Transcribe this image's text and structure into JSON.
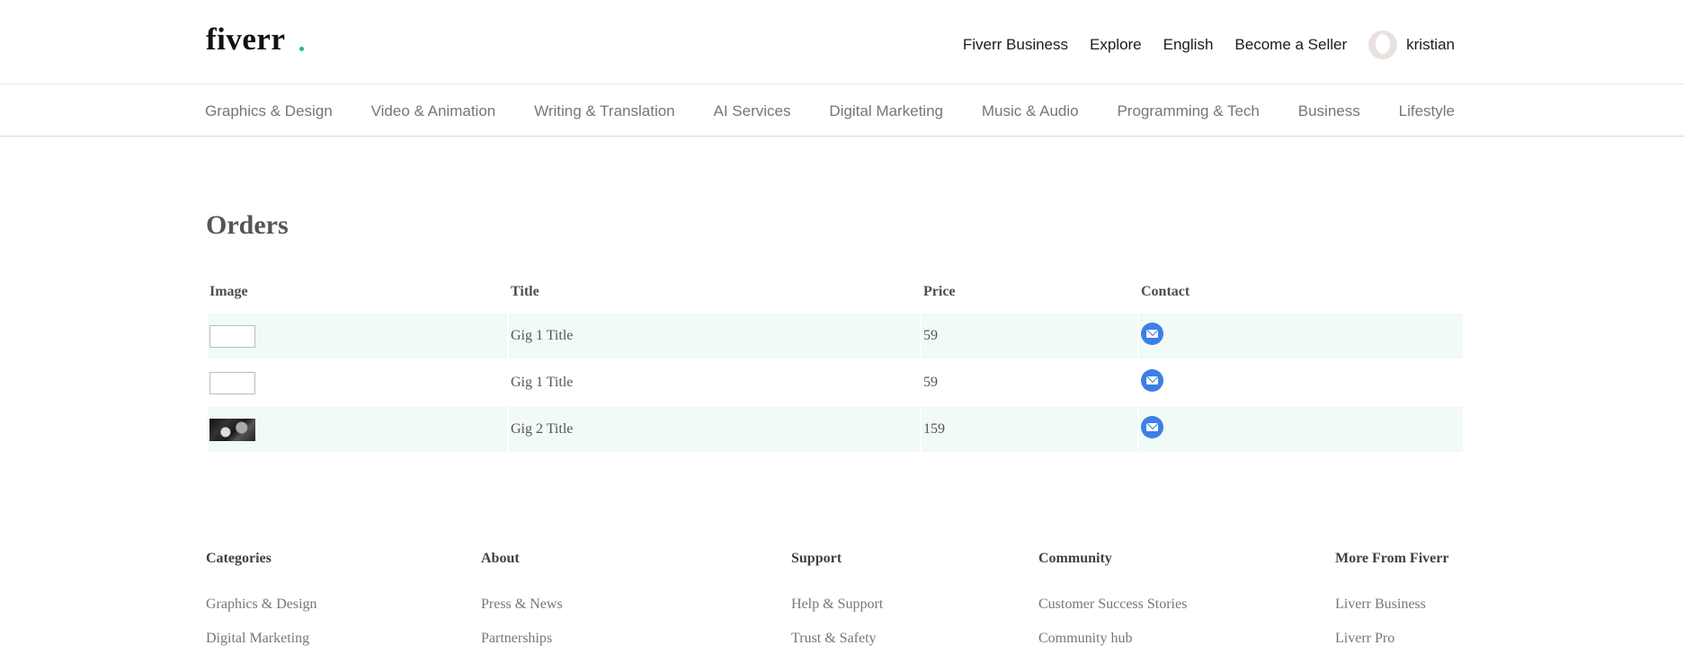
{
  "header": {
    "logo": "fiverr",
    "links": [
      "Fiverr Business",
      "Explore",
      "English",
      "Become a Seller"
    ],
    "username": "kristian"
  },
  "categories": [
    "Graphics & Design",
    "Video & Animation",
    "Writing & Translation",
    "AI Services",
    "Digital Marketing",
    "Music & Audio",
    "Programming & Tech",
    "Business",
    "Lifestyle"
  ],
  "orders": {
    "title": "Orders",
    "columns": [
      "Image",
      "Title",
      "Price",
      "Contact"
    ],
    "rows": [
      {
        "title": "Gig 1 Title",
        "price": "59",
        "image": "blank"
      },
      {
        "title": "Gig 1 Title",
        "price": "59",
        "image": "blank"
      },
      {
        "title": "Gig 2 Title",
        "price": "159",
        "image": "photo"
      }
    ]
  },
  "footer": {
    "columns": [
      {
        "heading": "Categories",
        "links": [
          "Graphics & Design",
          "Digital Marketing"
        ]
      },
      {
        "heading": "About",
        "links": [
          "Press & News",
          "Partnerships"
        ]
      },
      {
        "heading": "Support",
        "links": [
          "Help & Support",
          "Trust & Safety"
        ]
      },
      {
        "heading": "Community",
        "links": [
          "Customer Success Stories",
          "Community hub"
        ]
      },
      {
        "heading": "More From Fiverr",
        "links": [
          "Liverr Business",
          "Liverr Pro"
        ]
      }
    ]
  },
  "colors": {
    "brand_green": "#1dbf73",
    "row_highlight": "#f1faf6",
    "contact_blue": "#3d7fe6"
  }
}
